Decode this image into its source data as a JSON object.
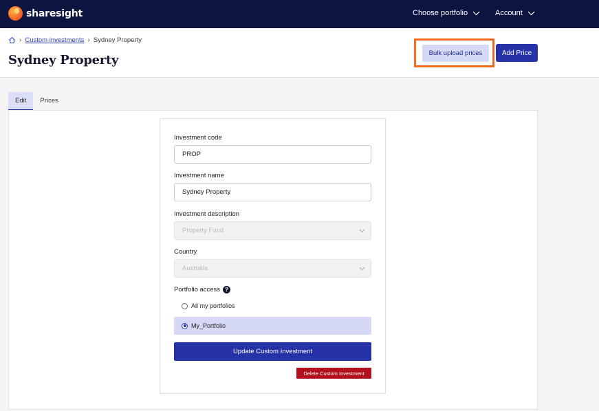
{
  "app": {
    "brand": "sharesight"
  },
  "topnav": {
    "portfolio_label": "Choose portfolio",
    "account_label": "Account"
  },
  "breadcrumb": {
    "home_icon": "home-icon",
    "link_label": "Custom investments",
    "current": "Sydney Property"
  },
  "page": {
    "title": "Sydney Property"
  },
  "actions": {
    "bulk_upload_label": "Bulk upload prices",
    "add_price_label": "Add Price",
    "highlight_color": "#f26a1b"
  },
  "tabs": [
    {
      "label": "Edit",
      "active": true
    },
    {
      "label": "Prices",
      "active": false
    }
  ],
  "form": {
    "code_label": "Investment code",
    "code_value": "PROP",
    "name_label": "Investment name",
    "name_value": "Sydney Property",
    "description_label": "Investment description",
    "description_value": "Property Fund",
    "country_label": "Country",
    "country_value": "Australia",
    "access_label": "Portfolio access",
    "access_help_icon": "question-icon",
    "access_options": [
      {
        "label": "All my portfolios",
        "selected": false
      },
      {
        "label": "My_Portfolio",
        "selected": true
      }
    ],
    "update_label": "Update Custom Investment",
    "delete_label": "Delete Custom Investment"
  },
  "colors": {
    "navbar": "#0e1440",
    "primary": "#2532a8",
    "primary_light": "#d5d9f6",
    "danger": "#b3101d"
  }
}
